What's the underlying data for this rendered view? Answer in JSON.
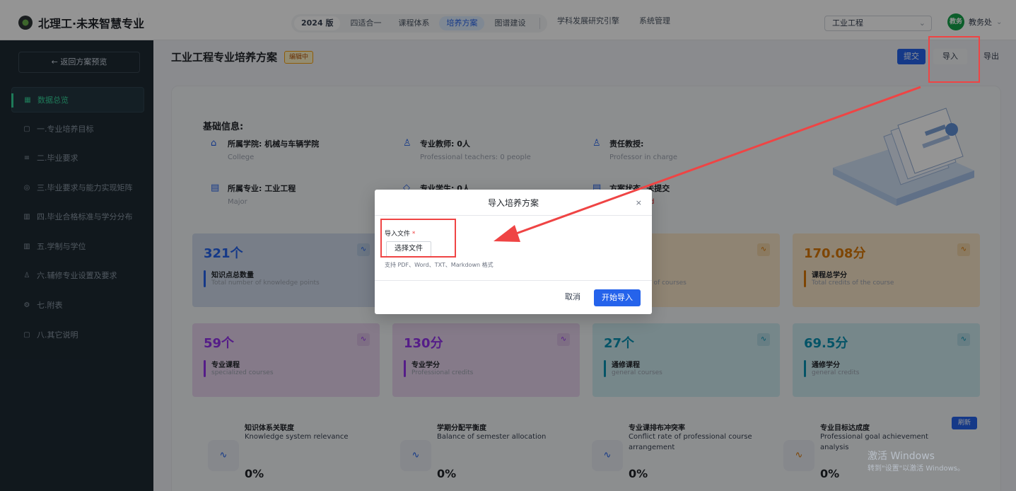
{
  "app": {
    "title": "北理工·未来智慧专业"
  },
  "nav": {
    "version_badge": "2024 版",
    "items": [
      "四适合一",
      "课程体系",
      "培养方案",
      "图谱建设"
    ],
    "right_items": [
      "学科发展研究引擎",
      "系统管理"
    ]
  },
  "header": {
    "major_select": "工业工程",
    "user": {
      "avatar": "教务",
      "name": "教务处"
    }
  },
  "sidebar": {
    "back": "← 返回方案预览",
    "items": [
      {
        "label": "数据总览",
        "icon": "grid-icon"
      },
      {
        "label": "一.专业培养目标",
        "icon": "doc-icon"
      },
      {
        "label": "二.毕业要求",
        "icon": "list-icon"
      },
      {
        "label": "三.毕业要求与能力实现矩阵",
        "icon": "circle-icon"
      },
      {
        "label": "四.毕业合格标准与学分分布",
        "icon": "book-icon"
      },
      {
        "label": "五.学制与学位",
        "icon": "book-icon"
      },
      {
        "label": "六.辅修专业设置及要求",
        "icon": "user-icon"
      },
      {
        "label": "七.附表",
        "icon": "gear-icon"
      },
      {
        "label": "八.其它说明",
        "icon": "doc-icon"
      }
    ]
  },
  "page": {
    "title": "工业工程专业培养方案",
    "status": "编辑中",
    "actions": {
      "submit": "提交",
      "import": "导入",
      "export": "导出"
    }
  },
  "basic_info": {
    "heading": "基础信息:",
    "college": {
      "label": "所属学院:  机械与车辆学院",
      "sub": "College"
    },
    "teachers": {
      "label": "专业教师:  0人",
      "sub": "Professional teachers: 0 people"
    },
    "professor": {
      "label": "责任教授:",
      "sub": "Professor in charge"
    },
    "major": {
      "label": "所属专业:  工业工程",
      "sub": "Major"
    },
    "students": {
      "label": "专业学生:  0人"
    },
    "plan_status": {
      "label": "方案状态:  未提交",
      "sub": "unsubmitted"
    }
  },
  "cards": [
    {
      "value": "321个",
      "label": "知识点总数量",
      "sub": "Total number of knowledge points",
      "color": "#2563eb",
      "bg": "#cfdaea"
    },
    {
      "value": "",
      "label": "",
      "sub": "r of courses",
      "color": "#d97706",
      "bg": "#f7e3c7"
    },
    {
      "value": "170.08分",
      "label": "课程总学分",
      "sub": "Total credits of the course",
      "color": "#d97706",
      "bg": "#f7e3c7"
    },
    {
      "value": "59个",
      "label": "专业课程",
      "sub": "specialized courses",
      "color": "#9333ea",
      "bg": "#e5d3ec"
    },
    {
      "value": "130分",
      "label": "专业学分",
      "sub": "Professional credits",
      "color": "#9333ea",
      "bg": "#e5d3ec"
    },
    {
      "value": "27个",
      "label": "通修课程",
      "sub": "general courses",
      "color": "#0891b2",
      "bg": "#cce8ee"
    },
    {
      "value": "69.5分",
      "label": "通修学分",
      "sub": "general credits",
      "color": "#0891b2",
      "bg": "#cce8ee"
    }
  ],
  "metrics": [
    {
      "title": "知识体系关联度",
      "sub": "Knowledge system relevance",
      "value": "0%"
    },
    {
      "title": "学期分配平衡度",
      "sub": "Balance of semester allocation",
      "value": "0%"
    },
    {
      "title": "专业课排布冲突率",
      "sub": "Conflict rate of professional course arrangement",
      "value": "0%"
    },
    {
      "title": "专业目标达成度",
      "sub": "Professional goal achievement analysis",
      "value": "0%"
    }
  ],
  "refresh": "刷新",
  "watermark": {
    "line1": "激活 Windows",
    "line2": "转到\"设置\"以激活 Windows。"
  },
  "modal": {
    "title": "导入培养方案",
    "field_label": "导入文件",
    "required_mark": "*",
    "choose_file": "选择文件",
    "hint": "支持 PDF、Word、TXT、Markdown 格式",
    "cancel": "取消",
    "start": "开始导入"
  },
  "colors": {
    "accent": "#2563eb",
    "sidebar_bg": "#1e2a33",
    "active": "#34d399",
    "annotation": "#ef4444"
  }
}
